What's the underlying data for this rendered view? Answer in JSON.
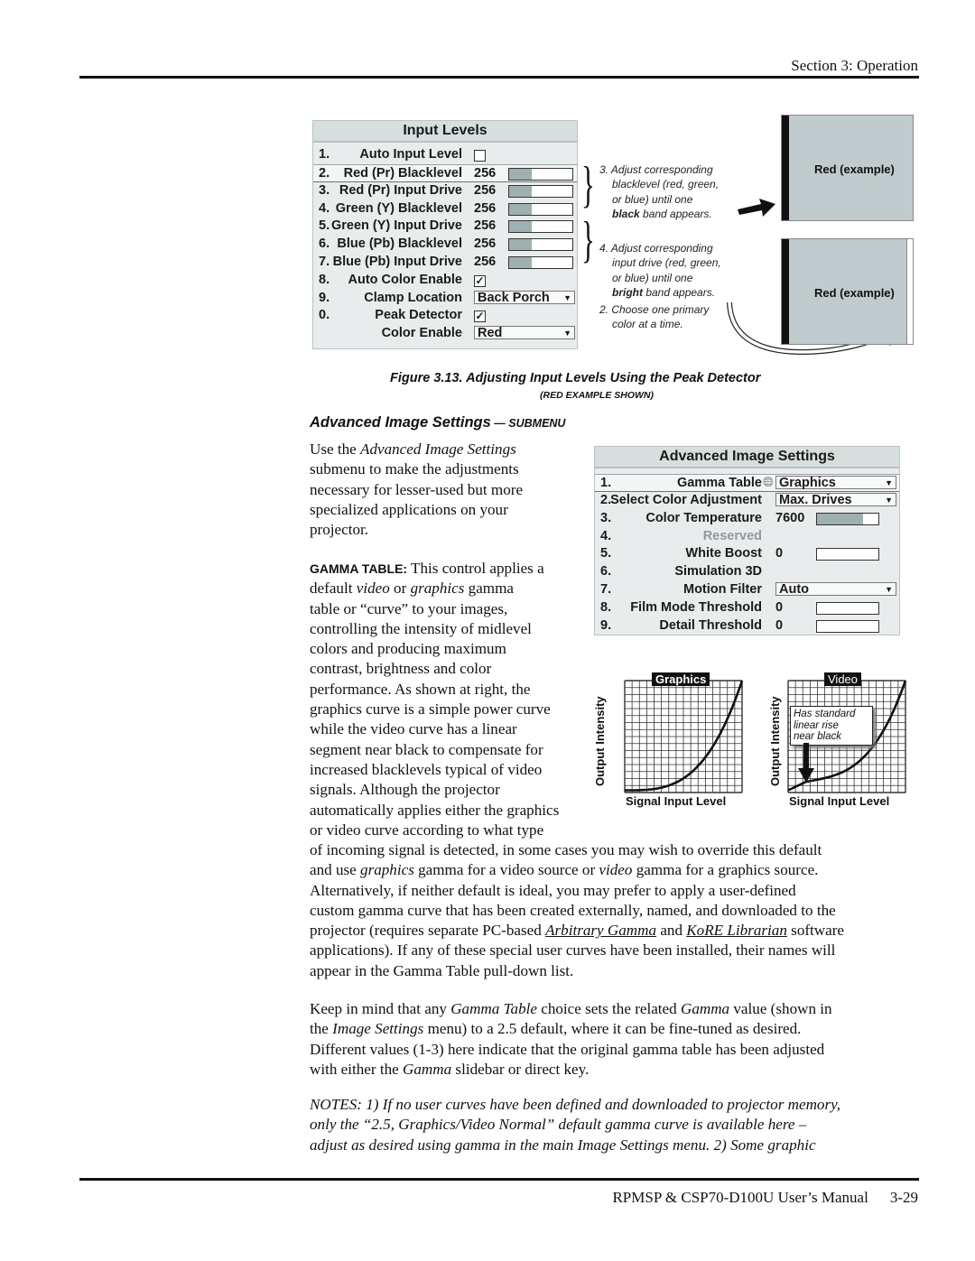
{
  "header": {
    "section": "Section 3: Operation"
  },
  "footer": {
    "manual": "RPMSP & CSP70-D100U User’s Manual",
    "page": "3-29"
  },
  "input_levels_menu": {
    "title": "Input Levels",
    "rows": [
      {
        "num": "1.",
        "label": "Auto Input Level",
        "type": "checkbox",
        "checked": ""
      },
      {
        "num": "2.",
        "label": "Red (Pr) Blacklevel",
        "type": "slider",
        "value": "256",
        "fill": 0.35,
        "selected": true
      },
      {
        "num": "3.",
        "label": "Red (Pr) Input Drive",
        "type": "slider",
        "value": "256",
        "fill": 0.35
      },
      {
        "num": "4.",
        "label": "Green (Y) Blacklevel",
        "type": "slider",
        "value": "256",
        "fill": 0.35
      },
      {
        "num": "5.",
        "label": "Green (Y) Input Drive",
        "type": "slider",
        "value": "256",
        "fill": 0.35
      },
      {
        "num": "6.",
        "label": "Blue (Pb) Blacklevel",
        "type": "slider",
        "value": "256",
        "fill": 0.35
      },
      {
        "num": "7.",
        "label": "Blue (Pb) Input Drive",
        "type": "slider",
        "value": "256",
        "fill": 0.35
      },
      {
        "num": "8.",
        "label": "Auto Color Enable",
        "type": "checkbox",
        "checked": "✓"
      },
      {
        "num": "9.",
        "label": "Clamp Location",
        "type": "dropdown",
        "value": "Back Porch"
      },
      {
        "num": "0.",
        "label": "Peak Detector",
        "type": "checkbox",
        "checked": "✓"
      },
      {
        "num": "",
        "label": "Color Enable",
        "type": "dropdown",
        "value": "Red"
      }
    ]
  },
  "figure_notes": {
    "note3_line1": "3. Adjust corresponding",
    "note3_line2": "blacklevel (red, green,",
    "note3_line3": "or blue) until one",
    "note3_bold": "black",
    "note3_tail": " band appears.",
    "note4_line1": "4. Adjust corresponding",
    "note4_line2": "input drive (red, green,",
    "note4_line3": "or blue) until one",
    "note4_bold": "bright",
    "note4_tail": " band appears.",
    "note2_line1": "2. Choose one primary",
    "note2_line2": "color at a time.",
    "example_top_label": "Red (example)",
    "example_bottom_label": "Red (example)"
  },
  "figure_caption": {
    "title": "Figure 3.13. Adjusting Input Levels Using the Peak Detector",
    "subtitle": "(RED EXAMPLE SHOWN)"
  },
  "section_heading": {
    "main": "Advanced Image Settings",
    "dash": " — ",
    "sub": "SUBMENU"
  },
  "advanced_menu": {
    "title": "Advanced Image Settings",
    "rows": [
      {
        "num": "1.",
        "label": "Gamma Table",
        "type": "dropdown",
        "value": "Graphics",
        "selected": true,
        "icon": "globe-icon"
      },
      {
        "num": "2.",
        "label": "Select Color Adjustment",
        "type": "dropdown",
        "value": "Max. Drives"
      },
      {
        "num": "3.",
        "label": "Color Temperature",
        "type": "slider",
        "value": "7600",
        "fill": 0.75
      },
      {
        "num": "4.",
        "label": "Reserved",
        "type": "none",
        "disabled": true
      },
      {
        "num": "5.",
        "label": "White Boost",
        "type": "slider",
        "value": "0",
        "fill": 0
      },
      {
        "num": "6.",
        "label": "Simulation 3D",
        "type": "none"
      },
      {
        "num": "7.",
        "label": "Motion Filter",
        "type": "dropdown",
        "value": "Auto"
      },
      {
        "num": "8.",
        "label": "Film Mode Threshold",
        "type": "slider",
        "value": "0",
        "fill": 0
      },
      {
        "num": "9.",
        "label": "Detail Threshold",
        "type": "slider",
        "value": "0",
        "fill": 0
      }
    ]
  },
  "intro_paragraph": {
    "l1a": "Use the ",
    "l1b": "Advanced Image Settings",
    "l2": "submenu to make the adjustments",
    "l3": "necessary for lesser-used but more",
    "l4": "specialized applications on your",
    "l5": "projector."
  },
  "gamma_paragraph": {
    "keyword": "GAMMA TABLE:",
    "lines": [
      " This control applies a",
      "default |video| or |graphics| gamma",
      "table or “curve” to your images,",
      "controlling the intensity of midlevel",
      "colors and producing maximum",
      "contrast, brightness and color",
      "performance. As shown at right, the",
      "graphics curve is a simple power curve",
      "while the video curve has a linear",
      "segment near black to compensate for",
      "increased blacklevels typical of video",
      "signals. Although the projector",
      "automatically applies either the graphics",
      "or video curve according to what type"
    ],
    "w1": "default ",
    "w2": "video",
    "w3": " or ",
    "w4": "graphics",
    "w5": " gamma",
    "full_lines": [
      "of incoming signal is detected, in some cases you may wish to override this default",
      "Alternatively, if neither default is ideal, you may prefer to apply a user-defined",
      "custom gamma curve that has been created externally, named, and downloaded to the",
      "applications). If any of these special user curves have been installed, their names will",
      "appear in the Gamma Table pull-down list."
    ],
    "line2a": "and use ",
    "line2b": "graphics",
    "line2c": " gamma for a video source or ",
    "line2d": "video",
    "line2e": " gamma for a graphics source.",
    "line5a": "projector (requires separate PC-based ",
    "line5b": "Arbitrary Gamma",
    "line5c": " and ",
    "line5d": "KoRE Librarian",
    "line5e": " software"
  },
  "keep_paragraph": {
    "a1": "Keep in mind that any ",
    "a2": "Gamma Table",
    "a3": " choice sets the related ",
    "a4": "Gamma",
    "a5": " value (shown in",
    "b1": "the ",
    "b2": "Image Settings",
    "b3": " menu) to a 2.5 default, where it can be fine-tuned as desired.",
    "c": "Different values (1-3) here indicate that the original gamma table has been adjusted",
    "d1": "with either the ",
    "d2": "Gamma",
    "d3": " slidebar or direct key."
  },
  "notes_paragraph": {
    "l1": "NOTES: 1) If no user curves have been defined and downloaded to projector memory,",
    "l2": "only the “2.5, Graphics/Video Normal” default gamma curve is available here –",
    "l3": "adjust as desired using gamma in the main Image Settings menu. 2) Some graphic"
  },
  "gamma_graphs": [
    {
      "tag": "Graphics",
      "ylabel": "Output Intensity",
      "xlabel": "Signal Input Level"
    },
    {
      "tag": "Video",
      "ylabel": "Output Intensity",
      "xlabel": "Signal Input Level",
      "callout": [
        "Has standard",
        "linear rise",
        "near black"
      ]
    }
  ]
}
